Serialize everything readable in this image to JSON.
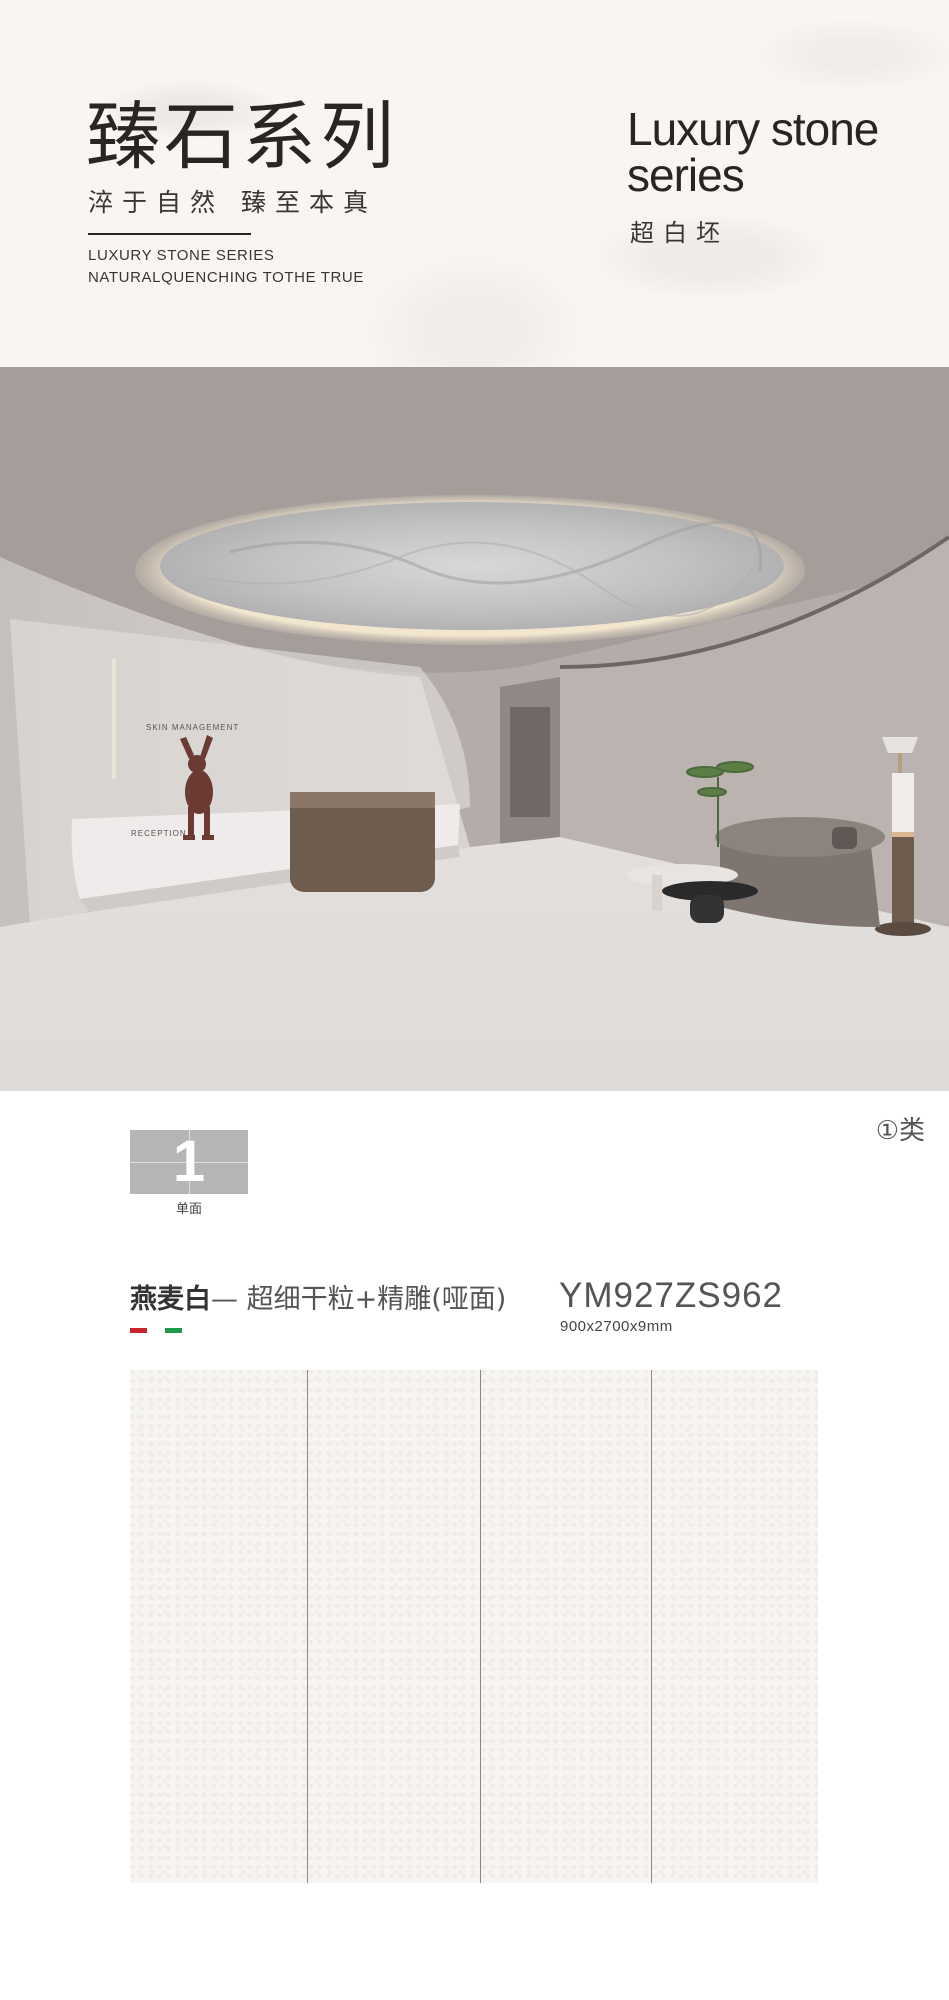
{
  "header": {
    "title_cn": "臻石系列",
    "subtitle_cn": "淬于自然 臻至本真",
    "subtitle_en_line1": "LUXURY STONE SERIES",
    "subtitle_en_line2": "NATURALQUENCHING TOTHE TRUE",
    "title_en_line1": "Luxury stone",
    "title_en_line2": "series",
    "title_en_cn": "超白坯"
  },
  "scene": {
    "sign_text": "SKIN MANAGEMENT",
    "reception_text": "RECEPTION"
  },
  "product": {
    "class_label": "①类",
    "face_number": "1",
    "face_label": "单面",
    "name_strong": "燕麦白",
    "name_rest": "— 超细干粒+精雕(哑面)",
    "code": "YM927ZS962",
    "size": "900x2700x9mm",
    "flag_colors": [
      "#c8242b",
      "#ffffff",
      "#1f9a4a"
    ],
    "slab_count": 4
  }
}
